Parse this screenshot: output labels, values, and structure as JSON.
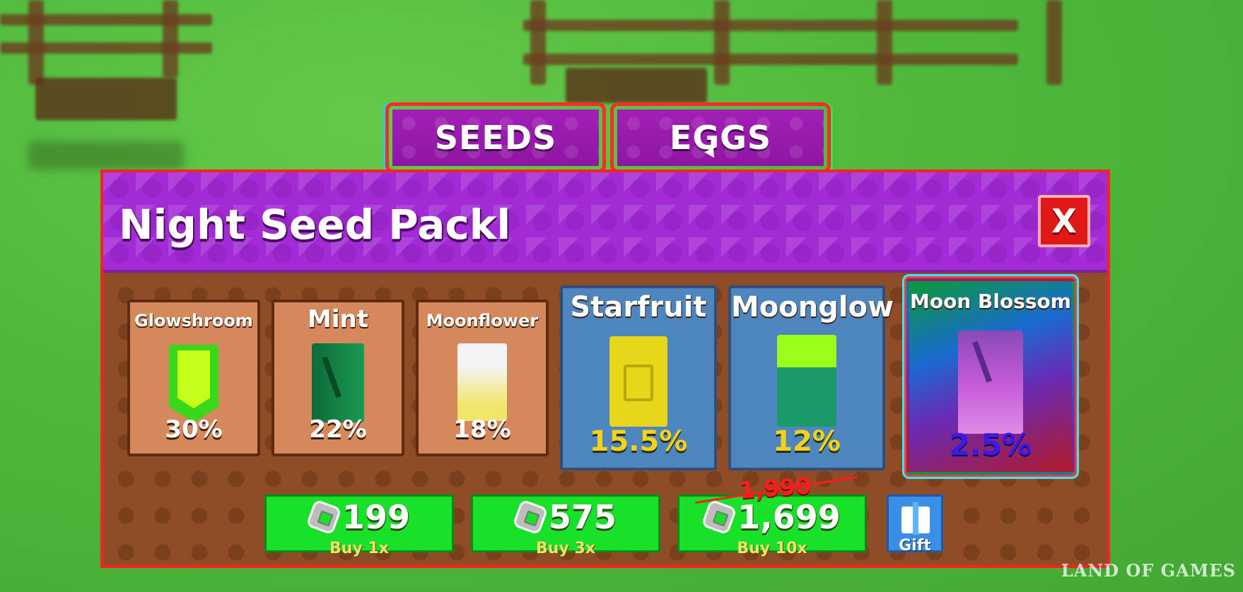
{
  "tabs": [
    {
      "label": "SEEDS"
    },
    {
      "label": "EGGS"
    }
  ],
  "panel": {
    "title": "Night Seed Packl",
    "close_label": "X"
  },
  "seeds": [
    {
      "name": "Glowshroom",
      "chance": "30%",
      "rarity": "common",
      "color": "#a6f21a"
    },
    {
      "name": "Mint",
      "chance": "22%",
      "rarity": "common",
      "color": "#168a4a"
    },
    {
      "name": "Moonflower",
      "chance": "18%",
      "rarity": "common",
      "color": "#f2e66a"
    },
    {
      "name": "Starfruit",
      "chance": "15.5%",
      "rarity": "rare",
      "color": "#e8d61a"
    },
    {
      "name": "Moonglow",
      "chance": "12%",
      "rarity": "rare",
      "color": "#1a9a6a"
    },
    {
      "name": "Moon Blossom",
      "chance": "2.5%",
      "rarity": "legendary",
      "color": "#c45ad6"
    }
  ],
  "buy": [
    {
      "price": "199",
      "label": "Buy 1x"
    },
    {
      "price": "575",
      "label": "Buy 3x"
    },
    {
      "price": "1,699",
      "label": "Buy 10x",
      "old_price": "1,990"
    }
  ],
  "gift": {
    "label": "Gift",
    "icon": "gift-icon"
  },
  "watermark": "LAND OF GAMES",
  "colors": {
    "panel_header": "#a32bd6",
    "panel_body": "#8e4d27",
    "buy_button": "#18e12a",
    "rare_percent": "#f2d21a",
    "legendary_percent": "#3a1ae6"
  }
}
